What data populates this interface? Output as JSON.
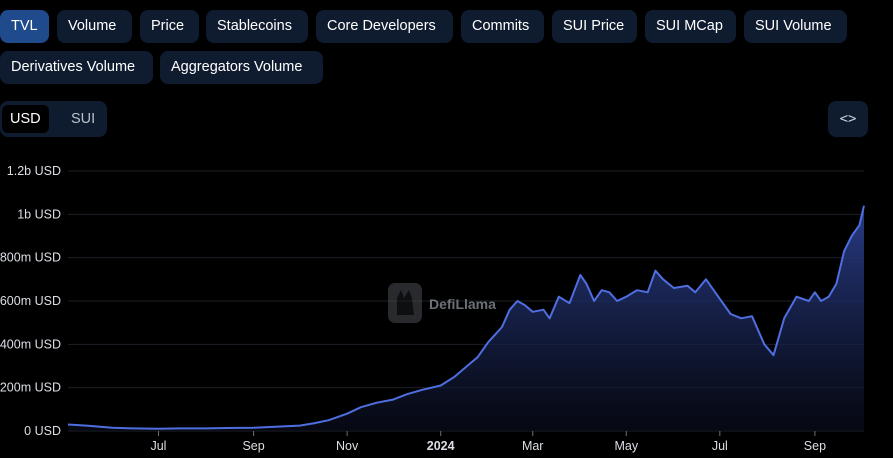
{
  "tabs": [
    {
      "label": "TVL",
      "active": true
    },
    {
      "label": "Volume"
    },
    {
      "label": "Price"
    },
    {
      "label": "Stablecoins"
    },
    {
      "label": "Core Developers"
    },
    {
      "label": "Commits"
    },
    {
      "label": "SUI Price"
    },
    {
      "label": "SUI MCap"
    },
    {
      "label": "SUI Volume"
    },
    {
      "label": "Derivatives Volume"
    },
    {
      "label": "Aggregators Volume"
    }
  ],
  "currency_toggle": {
    "selected": "USD",
    "other": "SUI"
  },
  "embed_icon": "code-brackets-icon",
  "watermark": {
    "text": "DefiLlama",
    "icon": "llama-logo-icon"
  },
  "colors": {
    "line": "#4f6ee0",
    "active_tab": "#1f4a8c",
    "tab_bg": "#0f1b2f",
    "grid": "#1c1f26"
  },
  "chart_data": {
    "type": "area",
    "yticks": [
      "0 USD",
      "200m USD",
      "400m USD",
      "600m USD",
      "800m USD",
      "1b USD",
      "1.2b USD"
    ],
    "ylim": [
      0,
      1200
    ],
    "yunit": "m USD",
    "xticks": [
      {
        "label": "Jul",
        "date": "2023-07-01"
      },
      {
        "label": "Sep",
        "date": "2023-09-01"
      },
      {
        "label": "Nov",
        "date": "2023-11-01"
      },
      {
        "label": "2024",
        "date": "2024-01-01",
        "bold": true
      },
      {
        "label": "Mar",
        "date": "2024-03-01"
      },
      {
        "label": "May",
        "date": "2024-05-01"
      },
      {
        "label": "Jul",
        "date": "2024-07-01"
      },
      {
        "label": "Sep",
        "date": "2024-09-01"
      }
    ],
    "series": [
      {
        "x": [
          "2023-05-03",
          "2023-05-15",
          "2023-06-01",
          "2023-06-15",
          "2023-07-01",
          "2023-07-15",
          "2023-08-01",
          "2023-08-15",
          "2023-09-01",
          "2023-09-15",
          "2023-10-01",
          "2023-10-10",
          "2023-10-20",
          "2023-11-01",
          "2023-11-10",
          "2023-11-20",
          "2023-12-01",
          "2023-12-10",
          "2023-12-20",
          "2024-01-01",
          "2024-01-10",
          "2024-01-20",
          "2024-01-25",
          "2024-02-01",
          "2024-02-10",
          "2024-02-15",
          "2024-02-20",
          "2024-02-25",
          "2024-03-01",
          "2024-03-08",
          "2024-03-12",
          "2024-03-18",
          "2024-03-25",
          "2024-04-01",
          "2024-04-05",
          "2024-04-10",
          "2024-04-15",
          "2024-04-20",
          "2024-04-25",
          "2024-05-01",
          "2024-05-08",
          "2024-05-15",
          "2024-05-20",
          "2024-05-25",
          "2024-06-01",
          "2024-06-10",
          "2024-06-15",
          "2024-06-22",
          "2024-07-01",
          "2024-07-08",
          "2024-07-15",
          "2024-07-22",
          "2024-07-30",
          "2024-08-05",
          "2024-08-12",
          "2024-08-20",
          "2024-08-28",
          "2024-09-01",
          "2024-09-05",
          "2024-09-10",
          "2024-09-15",
          "2024-09-20",
          "2024-09-25",
          "2024-09-30",
          "2024-10-03"
        ],
        "y": [
          30,
          25,
          15,
          12,
          10,
          12,
          12,
          14,
          15,
          20,
          25,
          35,
          50,
          80,
          110,
          130,
          145,
          170,
          190,
          210,
          250,
          310,
          340,
          410,
          480,
          560,
          600,
          580,
          550,
          560,
          520,
          620,
          590,
          720,
          680,
          600,
          650,
          640,
          600,
          620,
          650,
          640,
          740,
          700,
          660,
          670,
          640,
          700,
          610,
          540,
          520,
          530,
          400,
          350,
          520,
          620,
          600,
          640,
          600,
          620,
          680,
          830,
          900,
          950,
          1040
        ]
      }
    ]
  }
}
